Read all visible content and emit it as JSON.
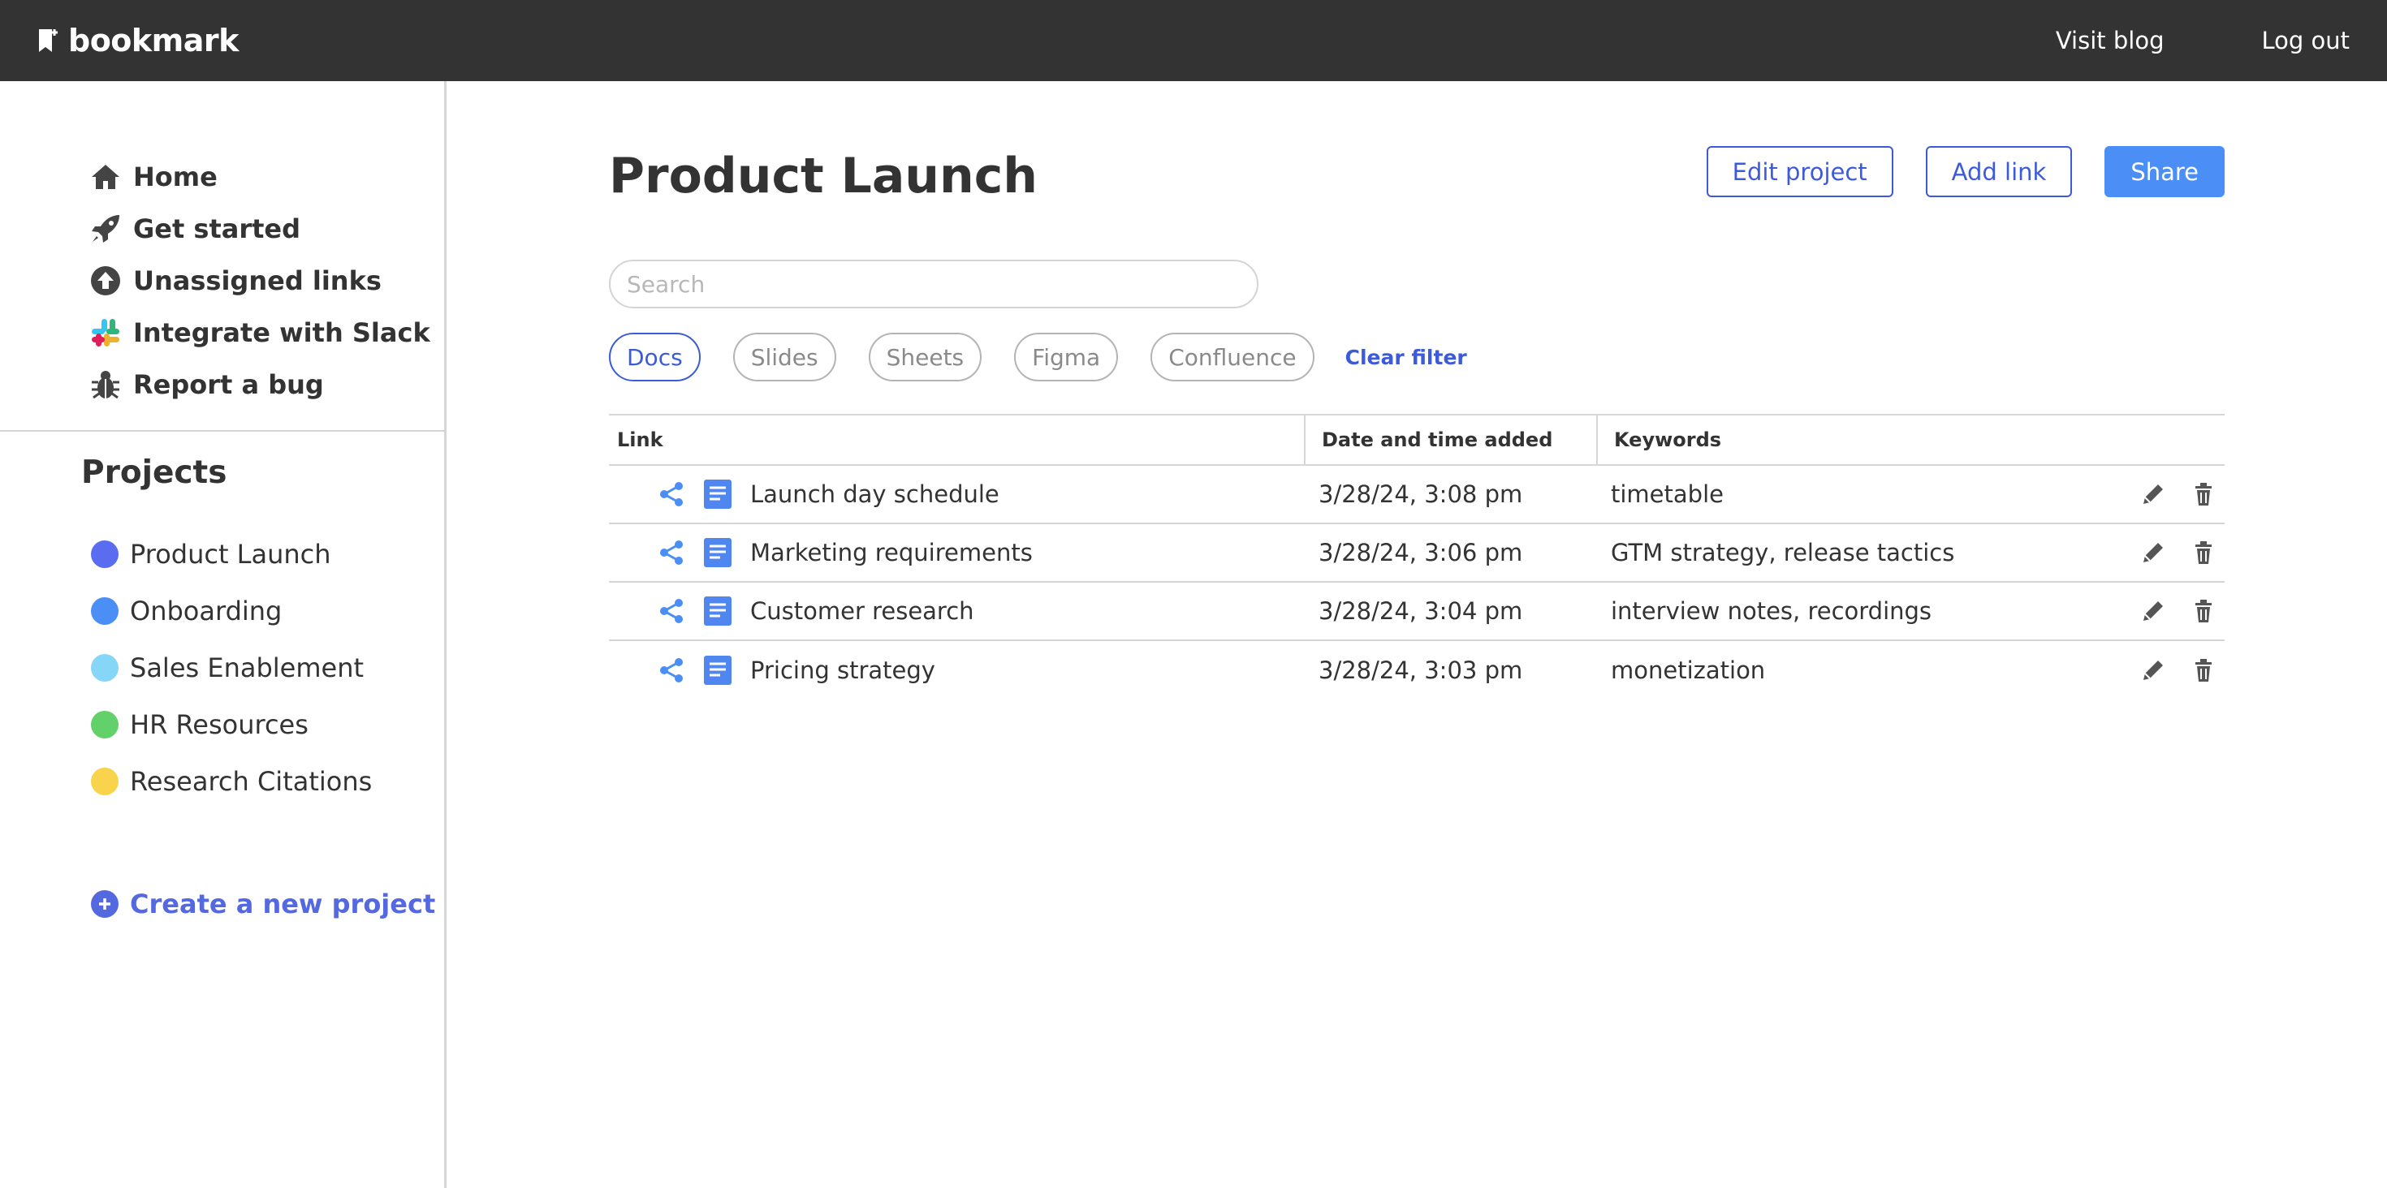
{
  "brand": {
    "name": "bookmark"
  },
  "topnav": {
    "visit_blog": "Visit blog",
    "log_out": "Log out"
  },
  "sidebar": {
    "nav": [
      {
        "label": "Home",
        "icon": "home-icon"
      },
      {
        "label": "Get started",
        "icon": "rocket-icon"
      },
      {
        "label": "Unassigned links",
        "icon": "upload-arrow-icon"
      },
      {
        "label": "Integrate with Slack",
        "icon": "slack-icon"
      },
      {
        "label": "Report a bug",
        "icon": "bug-icon"
      }
    ],
    "projects_title": "Projects",
    "projects": [
      {
        "label": "Product Launch",
        "color": "#5a6cf0"
      },
      {
        "label": "Onboarding",
        "color": "#4b8ef5"
      },
      {
        "label": "Sales Enablement",
        "color": "#86d6f7"
      },
      {
        "label": "HR Resources",
        "color": "#63d16a"
      },
      {
        "label": "Research Citations",
        "color": "#f8d34b"
      }
    ],
    "create_project": "Create a new project"
  },
  "main": {
    "title": "Product Launch",
    "buttons": {
      "edit": "Edit project",
      "add": "Add link",
      "share": "Share"
    },
    "search": {
      "placeholder": "Search",
      "value": ""
    },
    "filters": [
      {
        "label": "Docs",
        "active": true
      },
      {
        "label": "Slides",
        "active": false
      },
      {
        "label": "Sheets",
        "active": false
      },
      {
        "label": "Figma",
        "active": false
      },
      {
        "label": "Confluence",
        "active": false
      }
    ],
    "clear_filter": "Clear filter",
    "table": {
      "columns": {
        "link": "Link",
        "date": "Date and time added",
        "keywords": "Keywords"
      },
      "rows": [
        {
          "name": "Launch day schedule",
          "date": "3/28/24, 3:08 pm",
          "keywords": "timetable"
        },
        {
          "name": "Marketing requirements",
          "date": "3/28/24, 3:06 pm",
          "keywords": "GTM strategy, release tactics"
        },
        {
          "name": "Customer research",
          "date": "3/28/24, 3:04 pm",
          "keywords": "interview notes, recordings"
        },
        {
          "name": "Pricing strategy",
          "date": "3/28/24, 3:03 pm",
          "keywords": "monetization"
        }
      ]
    }
  },
  "colors": {
    "topbar": "#333333",
    "accent": "#3d5bd9",
    "primary_button": "#4b8ef5",
    "doc_icon": "#4f86f0"
  }
}
